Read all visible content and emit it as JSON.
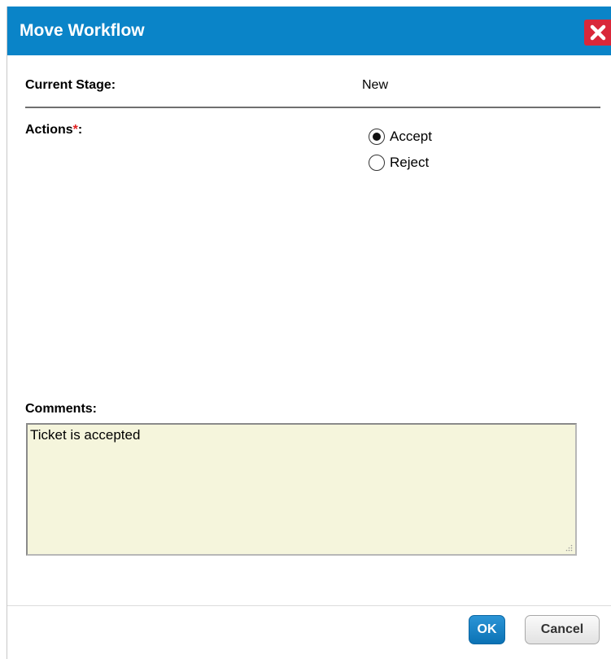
{
  "dialog": {
    "title": "Move Workflow",
    "close_icon": "close-x-icon"
  },
  "current_stage": {
    "label": "Current Stage:",
    "value": "New"
  },
  "actions": {
    "label": "Actions",
    "required_marker": "*",
    "suffix": ":",
    "options": [
      {
        "label": "Accept",
        "selected": true
      },
      {
        "label": "Reject",
        "selected": false
      }
    ]
  },
  "comments": {
    "label": "Comments:",
    "value": "Ticket is accepted"
  },
  "footer": {
    "ok_label": "OK",
    "cancel_label": "Cancel"
  },
  "colors": {
    "titlebar": "#0a84c8",
    "close_button": "#d9283a",
    "ok_button": "#0b72b5",
    "comments_bg": "#f5f5dc",
    "required": "#e02020"
  }
}
